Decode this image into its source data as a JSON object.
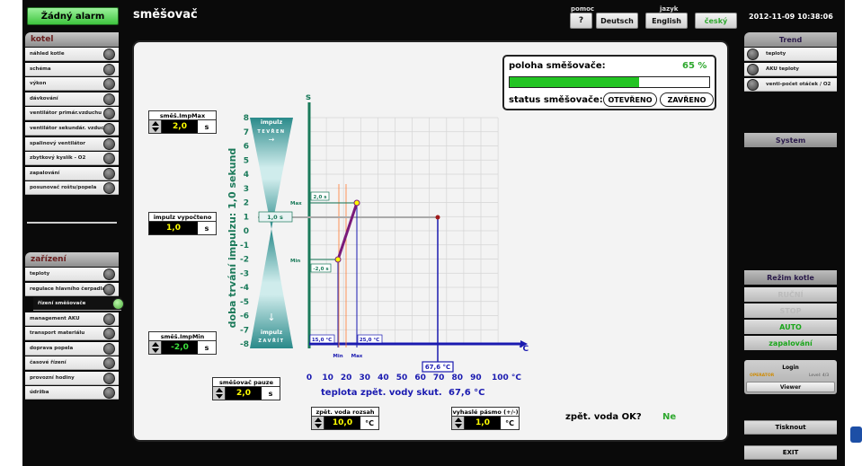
{
  "header": {
    "alarm": "Žádný alarm",
    "title": "směšovač",
    "help_caption": "pomoc",
    "help_btn": "?",
    "lang_caption": "jazyk",
    "lang_de": "Deutsch",
    "lang_en": "English",
    "lang_cz": "český",
    "datetime": "2012-11-09 10:38:06"
  },
  "left": {
    "kotel_title": "kotel",
    "kotel_items": [
      "náhled kotle",
      "schéma",
      "výkon",
      "dávkování",
      "ventilátor primár.vzduchu",
      "ventilátor sekundár. vzduchu",
      "spalinový ventilátor",
      "zbytkový kyslík - O2",
      "zapalování",
      "posunovač roštu/popela"
    ],
    "zarizeni_title": "zařízení",
    "zarizeni_items": [
      "teploty",
      "regulace hlavního čerpadla",
      "řízení směšovače",
      "management AKU",
      "transport materiálu",
      "doprava popela",
      "časové řízení",
      "provozní hodiny",
      "údržba"
    ]
  },
  "right": {
    "trend_title": "Trend",
    "trend_items": [
      "teploty",
      "AKU teploty",
      "venti-počet otáček / O2"
    ],
    "system_label": "System",
    "mode_title": "Režim kotle",
    "mode_rucni": "RUČNÍ",
    "mode_stop": "STOP",
    "mode_auto": "AUTO",
    "mode_zapal": "zapalování",
    "login_btn": "Login",
    "user": "OPERATOR",
    "level": "Level: 4/3",
    "viewer_btn": "Viewer",
    "print_btn": "Tisknout",
    "exit_btn": "EXIT"
  },
  "mixer": {
    "position_label": "poloha směšovače:",
    "position_value": "65 %",
    "position_pct": 65,
    "status_label": "status směšovače:",
    "open_btn": "OTEVŘENO",
    "close_btn": "ZAVŘENO"
  },
  "controls": {
    "impmax_label": "směš.ImpMax",
    "impmax_value": "2,0",
    "impmax_unit": "s",
    "impcalc_label": "impulz vypočteno",
    "impcalc_value": "1,0",
    "impcalc_unit": "s",
    "impmin_label": "směš.ImpMin",
    "impmin_value": "-2,0",
    "impmin_unit": "s",
    "pause_label": "směšovač pauze",
    "pause_value": "2,0",
    "pause_unit": "s",
    "range_label": "zpět. voda rozsah",
    "range_value": "10,0",
    "range_unit": "°C",
    "dead_label": "vyhaslé pásmo (+/-)",
    "dead_value": "1,0",
    "dead_unit": "°C",
    "water_ok_label": "zpět. voda OK?",
    "water_ok_value": "Ne"
  },
  "chart": {
    "open_label": "impulz",
    "open_sub": "TEVŘEN",
    "close_label": "impulz",
    "close_sub": "ZAVŘÍT",
    "y_axis_title": "doba trvání impulzu: 1,0 sekund",
    "y_unit": "s",
    "y_ticks": [
      "8",
      "7",
      "6",
      "5",
      "4",
      "3",
      "2",
      "1",
      "0",
      "-1",
      "-2",
      "-3",
      "-4",
      "-5",
      "-6",
      "-7",
      "-8"
    ],
    "x_ticks": [
      "0",
      "10",
      "20",
      "30",
      "40",
      "50",
      "60",
      "70",
      "80",
      "90",
      "100 °C"
    ],
    "x_unit": "°C",
    "x_title": "teplota zpět. vody skut.",
    "x_value": "67,6 °C",
    "cur_impulse": "1,0 s",
    "max_tag": "Max",
    "min_tag": "Min",
    "max_val": "2,0 s",
    "min_val": "-2,0 s",
    "xmin_tag": "Min",
    "xmax_tag": "Max",
    "xmin_val": "15,0 °C",
    "xmax_val": "25,0 °C",
    "cursor_val": "67,6 °C"
  }
}
